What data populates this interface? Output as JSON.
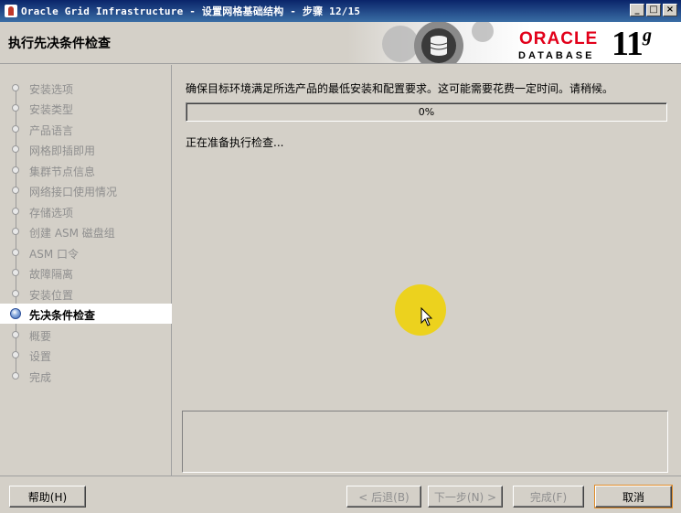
{
  "window": {
    "title": "Oracle Grid Infrastructure - 设置网格基础结构 - 步骤 12/15",
    "controls": {
      "minimize": "_",
      "maximize": "□",
      "close": "×"
    }
  },
  "header": {
    "page_title": "执行先决条件检查",
    "logo": {
      "brand": "ORACLE",
      "product": "DATABASE",
      "version": "11",
      "version_suffix": "g"
    }
  },
  "sidebar": {
    "steps": [
      {
        "label": "安装选项",
        "state": "done"
      },
      {
        "label": "安装类型",
        "state": "done"
      },
      {
        "label": "产品语言",
        "state": "done"
      },
      {
        "label": "网格即插即用",
        "state": "done"
      },
      {
        "label": "集群节点信息",
        "state": "done"
      },
      {
        "label": "网络接口使用情况",
        "state": "done"
      },
      {
        "label": "存储选项",
        "state": "done"
      },
      {
        "label": "创建 ASM 磁盘组",
        "state": "done"
      },
      {
        "label": "ASM 口令",
        "state": "done"
      },
      {
        "label": "故障隔离",
        "state": "done"
      },
      {
        "label": "安装位置",
        "state": "done"
      },
      {
        "label": "先决条件检查",
        "state": "active"
      },
      {
        "label": "概要",
        "state": "pending"
      },
      {
        "label": "设置",
        "state": "pending"
      },
      {
        "label": "完成",
        "state": "pending"
      }
    ]
  },
  "main": {
    "instruction": "确保目标环境满足所选产品的最低安装和配置要求。这可能需要花费一定时间。请稍候。",
    "progress": {
      "value": 0,
      "label": "0%"
    },
    "status": "正在准备执行检查..."
  },
  "footer": {
    "help": "帮助(H)",
    "back": "< 后退(B)",
    "next": "下一步(N) >",
    "finish": "完成(F)",
    "cancel": "取消"
  },
  "colors": {
    "oracle_red": "#e2001a",
    "active_highlight": "#ffffff",
    "cursor_highlight": "#f0d200"
  }
}
